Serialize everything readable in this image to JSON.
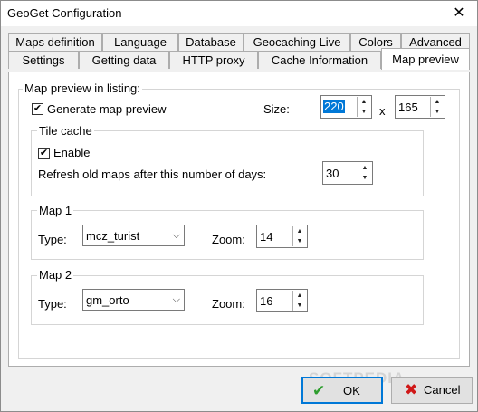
{
  "window": {
    "title": "GeoGet Configuration",
    "close_glyph": "✕"
  },
  "tabs_row1": [
    "Maps definition",
    "Language",
    "Database",
    "Geocaching Live",
    "Colors",
    "Advanced"
  ],
  "tabs_row2": [
    "Settings",
    "Getting data",
    "HTTP proxy",
    "Cache Information",
    "Map preview"
  ],
  "active_tab": "Map preview",
  "map_preview": {
    "group_label": "Map preview in listing:",
    "generate_label": "Generate map preview",
    "generate_checked": true,
    "size_label": "Size:",
    "width": "220",
    "x_label": "x",
    "height": "165"
  },
  "tile_cache": {
    "group_label": "Tile cache",
    "enable_label": "Enable",
    "enable_checked": true,
    "refresh_label": "Refresh old maps after this number of days:",
    "days": "30"
  },
  "map1": {
    "group_label": "Map 1",
    "type_label": "Type:",
    "type_value": "mcz_turist",
    "zoom_label": "Zoom:",
    "zoom_value": "14"
  },
  "map2": {
    "group_label": "Map 2",
    "type_label": "Type:",
    "type_value": "gm_orto",
    "zoom_label": "Zoom:",
    "zoom_value": "16"
  },
  "buttons": {
    "ok_label": "OK",
    "cancel_label": "Cancel"
  },
  "watermark": "SOFTPEDIA",
  "icons": {
    "check": "✔",
    "cross": "✖",
    "up": "▲",
    "down": "▼",
    "combo_arrow": "⌵"
  },
  "colors": {
    "ok_icon": "#2e9e2e",
    "cancel_icon": "#d01818",
    "selection": "#0078d7"
  }
}
